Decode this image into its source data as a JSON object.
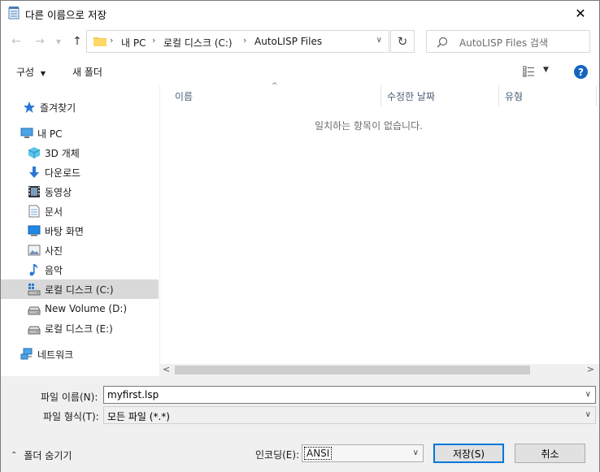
{
  "window": {
    "title": "다른 이름으로 저장"
  },
  "nav": {
    "back_icon": "arrow-left-icon",
    "forward_icon": "arrow-right-icon",
    "up_icon": "arrow-up-icon",
    "breadcrumbs": [
      "내 PC",
      "로컬 디스크 (C:)",
      "AutoLISP Files"
    ],
    "search_placeholder": "AutoLISP Files 검색"
  },
  "toolbar": {
    "organize_label": "구성",
    "new_folder_label": "새 폴더"
  },
  "sidebar": {
    "items": [
      {
        "label": "즐겨찾기",
        "icon": "star-icon",
        "selected": false
      },
      {
        "label": "내 PC",
        "icon": "computer-icon",
        "selected": false
      },
      {
        "label": "3D 개체",
        "icon": "3d-objects-icon",
        "selected": false
      },
      {
        "label": "다운로드",
        "icon": "download-icon",
        "selected": false
      },
      {
        "label": "동영상",
        "icon": "video-icon",
        "selected": false
      },
      {
        "label": "문서",
        "icon": "document-icon",
        "selected": false
      },
      {
        "label": "바탕 화면",
        "icon": "desktop-icon",
        "selected": false
      },
      {
        "label": "사진",
        "icon": "pictures-icon",
        "selected": false
      },
      {
        "label": "음악",
        "icon": "music-icon",
        "selected": false
      },
      {
        "label": "로컬 디스크 (C:)",
        "icon": "windows-drive-icon",
        "selected": true
      },
      {
        "label": "New Volume (D:)",
        "icon": "drive-icon",
        "selected": false
      },
      {
        "label": "로컬 디스크 (E:)",
        "icon": "drive-icon",
        "selected": false
      },
      {
        "label": "네트워크",
        "icon": "network-icon",
        "selected": false
      }
    ]
  },
  "filelist": {
    "columns": [
      "이름",
      "수정한 날짜",
      "유형"
    ],
    "empty_message": "일치하는 항목이 없습니다."
  },
  "form": {
    "filename_label": "파일 이름(N):",
    "filename_value": "myfirst.lsp",
    "filetype_label": "파일 형식(T):",
    "filetype_value": "모든 파일 (*.*)",
    "hide_folders_label": "폴더 숨기기",
    "encoding_label": "인코딩(E):",
    "encoding_value": "ANSI",
    "save_label": "저장(S)",
    "cancel_label": "취소"
  },
  "colors": {
    "accent": "#0078d7",
    "help": "#1565c0",
    "selected_row": "#d9d9d9",
    "panel_bg": "#f0f0f0"
  }
}
